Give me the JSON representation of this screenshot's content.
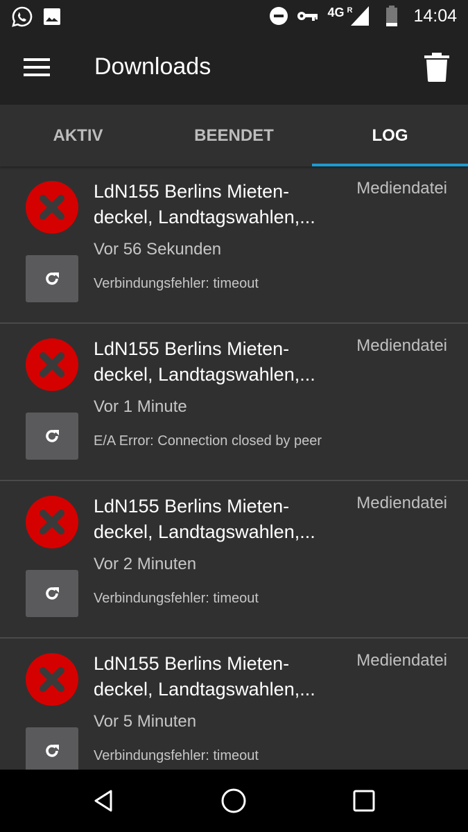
{
  "status_bar": {
    "left_icons": [
      "whatsapp-icon",
      "image-icon"
    ],
    "right_icons": [
      "do-not-disturb-icon",
      "vpn-key-icon",
      "signal-icon",
      "battery-icon"
    ],
    "network": "4G",
    "roaming": "R",
    "time": "14:04"
  },
  "app_bar": {
    "title": "Downloads",
    "menu_icon": "hamburger-menu-icon",
    "action_icon": "trash-icon"
  },
  "tabs": [
    {
      "label": "AKTIV",
      "active": false
    },
    {
      "label": "BEENDET",
      "active": false
    },
    {
      "label": "LOG",
      "active": true
    }
  ],
  "accent_color": "#1e9bd0",
  "error_color": "#d50000",
  "log_items": [
    {
      "title_line1": "LdN155 Berlins Mieten-",
      "title_line2": "deckel, Landtagswahlen,...",
      "type": "Mediendatei",
      "time": "Vor 56 Sekunden",
      "message": "Verbindungsfehler: timeout"
    },
    {
      "title_line1": "LdN155 Berlins Mieten-",
      "title_line2": "deckel, Landtagswahlen,...",
      "type": "Mediendatei",
      "time": "Vor 1 Minute",
      "message": "E/A Error: Connection closed by peer"
    },
    {
      "title_line1": "LdN155 Berlins Mieten-",
      "title_line2": "deckel, Landtagswahlen,...",
      "type": "Mediendatei",
      "time": "Vor 2 Minuten",
      "message": "Verbindungsfehler: timeout"
    },
    {
      "title_line1": "LdN155 Berlins Mieten-",
      "title_line2": "deckel, Landtagswahlen,...",
      "type": "Mediendatei",
      "time": "Vor 5 Minuten",
      "message": "Verbindungsfehler: timeout"
    }
  ],
  "nav_bar": [
    "back-icon",
    "home-icon",
    "recents-icon"
  ]
}
